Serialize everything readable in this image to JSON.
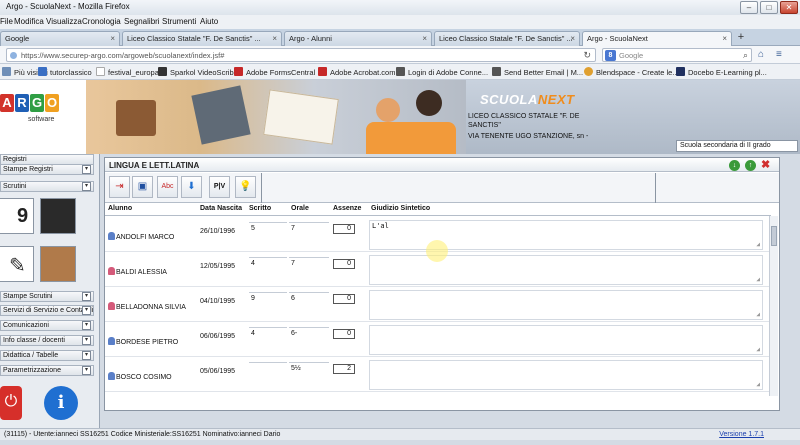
{
  "window": {
    "title": "Argo - ScuolaNext - Mozilla Firefox",
    "minimize": "–",
    "maximize": "□",
    "close": "✕"
  },
  "menu": [
    "File",
    "Modifica",
    "Visualizza",
    "Cronologia",
    "Segnalibri",
    "Strumenti",
    "Aiuto"
  ],
  "tabs": [
    {
      "label": "Google",
      "active": false
    },
    {
      "label": "Liceo Classico Statale \"F. De Sanctis\" ...",
      "active": false
    },
    {
      "label": "Argo - Alunni",
      "active": false
    },
    {
      "label": "Liceo Classico Statale \"F. De Sanctis\" ...",
      "active": false
    },
    {
      "label": "Argo - ScuolaNext",
      "active": true
    }
  ],
  "tab_close": "×",
  "new_tab": "+",
  "url": "https://www.securep-argo.com/argoweb/scuolanext/index.jsf#",
  "search_placeholder": "Google",
  "search_engine": "8",
  "bookmarks": [
    {
      "label": "Più visitati",
      "color": "#6f8fb8"
    },
    {
      "label": "tutorclassico",
      "color": "#3a6fc4"
    },
    {
      "label": "festival_europa",
      "color": "#ffffff"
    },
    {
      "label": "Sparkol VideoScribe",
      "color": "#333333"
    },
    {
      "label": "Adobe FormsCentral",
      "color": "#c62828"
    },
    {
      "label": "Adobe Acrobat.com",
      "color": "#c62828"
    },
    {
      "label": "Login di Adobe Conne...",
      "color": "#555555"
    },
    {
      "label": "Send Better Email | M...",
      "color": "#555555"
    },
    {
      "label": "Blendspace - Create le...",
      "color": "#e0a030"
    },
    {
      "label": "Docebo E-Learning pl...",
      "color": "#203060"
    }
  ],
  "header": {
    "logo_letters": [
      "A",
      "R",
      "G",
      "O"
    ],
    "logo_colors": [
      "#d2332b",
      "#1f5fb5",
      "#2f9e44",
      "#f0a020"
    ],
    "logo_sub": "software",
    "brand_a": "SCUOLA",
    "brand_b": "NEXT",
    "school_line1": "LICEO CLASSICO STATALE \"F. DE",
    "school_line2": "SANCTIS\"",
    "school_line3": "VIA TENENTE UGO STANZIONE, sn -",
    "school_select": "Scuola secondaria di II grado"
  },
  "sidebar": {
    "items": [
      "Registri",
      "Stampe Registri",
      "Scrutini",
      "Stampe Scrutini",
      "Servizi di Servizio e Contabili",
      "Comunicazioni",
      "Info classe / docenti",
      "Didattica / Tabelle",
      "Parametrizzazione"
    ],
    "chevron": "▾"
  },
  "panel": {
    "title": "LINGUA E LETT.LATINA",
    "columns": [
      "Alunno",
      "Data Nascita",
      "Scritto",
      "Orale",
      "Assenze",
      "Giudizio Sintetico"
    ],
    "rows": [
      {
        "name": "ANDOLFI MARCO",
        "dob": "26/10/1996",
        "scritto": "5",
        "orale": "7",
        "assenze": "0",
        "giudizio": "L'al",
        "icon_color": "#5a7fc8"
      },
      {
        "name": "BALDI ALESSIA",
        "dob": "12/05/1995",
        "scritto": "4",
        "orale": "7",
        "assenze": "0",
        "giudizio": "",
        "icon_color": "#d45a7a"
      },
      {
        "name": "BELLADONNA SILVIA",
        "dob": "04/10/1995",
        "scritto": "9",
        "orale": "6",
        "assenze": "0",
        "giudizio": "",
        "icon_color": "#d45a7a"
      },
      {
        "name": "BORDESE PIETRO",
        "dob": "06/06/1995",
        "scritto": "4",
        "orale": "6-",
        "assenze": "0",
        "giudizio": "",
        "icon_color": "#5a7fc8"
      },
      {
        "name": "BOSCO COSIMO",
        "dob": "05/06/1995",
        "scritto": "",
        "orale": "5½",
        "assenze": "2",
        "giudizio": "",
        "icon_color": "#5a7fc8"
      }
    ]
  },
  "status": {
    "text": "(31115) - Utente:ianneci SS16251 Codice Ministeriale:SS16251 Nominativo:ianneci Dario",
    "version": "Versione 1.7.1"
  }
}
